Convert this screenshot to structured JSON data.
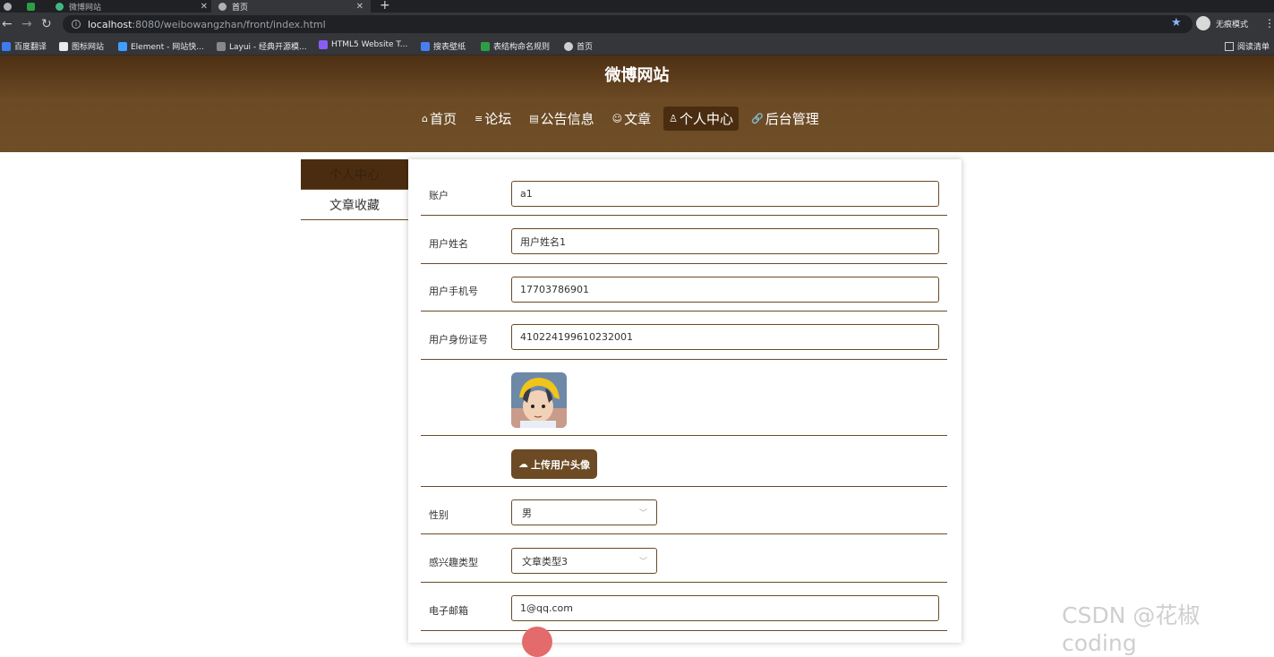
{
  "browser": {
    "tabs": [
      {
        "label": "微博网站"
      },
      {
        "label": "首页"
      }
    ],
    "url_host": "localhost",
    "url_path": ":8080/weibowangzhan/front/index.html",
    "incognito_label": "无痕模式",
    "bookmarks": [
      "百度翻译",
      "图标网站",
      "Element - 网站快...",
      "Layui - 经典开源模...",
      "HTML5 Website T...",
      "搜表壁纸",
      "表结构命名规则",
      "首页"
    ],
    "reading_list": "阅读清单"
  },
  "site": {
    "title": "微博网站",
    "nav": [
      {
        "label": "首页",
        "icon": "home-icon"
      },
      {
        "label": "论坛",
        "icon": "forum-icon"
      },
      {
        "label": "公告信息",
        "icon": "notice-icon"
      },
      {
        "label": "文章",
        "icon": "article-icon"
      },
      {
        "label": "个人中心",
        "icon": "user-icon",
        "active": true
      },
      {
        "label": "后台管理",
        "icon": "link-icon"
      }
    ]
  },
  "sidebar": {
    "items": [
      {
        "label": "个人中心",
        "active": true
      },
      {
        "label": "文章收藏"
      }
    ]
  },
  "form": {
    "account": {
      "label": "账户",
      "value": "a1"
    },
    "name": {
      "label": "用户姓名",
      "value": "用户姓名1"
    },
    "phone": {
      "label": "用户手机号",
      "value": "17703786901"
    },
    "id_card": {
      "label": "用户身份证号",
      "value": "410224199610232001"
    },
    "upload_label": "上传用户头像",
    "gender": {
      "label": "性别",
      "value": "男"
    },
    "interest": {
      "label": "感兴趣类型",
      "value": "文章类型3"
    },
    "email": {
      "label": "电子邮箱",
      "value": "1@qq.com"
    }
  },
  "watermark": "CSDN @花椒coding",
  "colors": {
    "brand": "#6b4a24",
    "brand_dark": "#4a2d10"
  }
}
